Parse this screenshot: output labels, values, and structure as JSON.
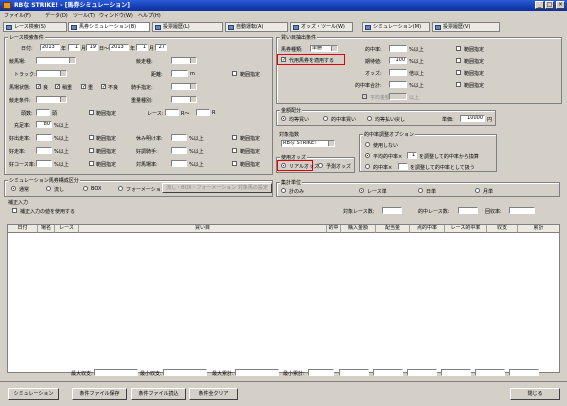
{
  "window": {
    "title": "RBな STRIKE! - [馬券シミュレーション]",
    "minimize": "_",
    "maximize": "□",
    "close": "×"
  },
  "menu": [
    "ファイル(F)",
    "データ(D)",
    "ツール(T)",
    "ウィンドウ(W)",
    "ヘルプ(H)"
  ],
  "tabs": [
    "レース検索(S)",
    "馬券シミュレーション(B)",
    "投票履歴(L)",
    "自動運転(A)",
    "オッズ・ツール(W)",
    "シミュレーション(M)",
    "投票履歴(V)"
  ],
  "race": {
    "title": "レース検索条件",
    "date_label": "日付:",
    "from_year": "2013",
    "year_label": "年",
    "from_month": "1",
    "month_label": "月",
    "from_day": "19",
    "day_label": "日〜",
    "to_year": "2013",
    "to_month": "1",
    "to_day": "27",
    "venue_label": "競馬場:",
    "racetype_label": "競走種:",
    "track_label": "トラック:",
    "distance_label": "距離:",
    "distance_unit": "m",
    "range_label": "範囲指定",
    "condition_label": "馬場状態:",
    "cond_items": [
      "良",
      "稍重",
      "重",
      "不良"
    ],
    "jockey_label": "騎手指定:",
    "class_label": "競走条件:",
    "weight_label": "重量種別:",
    "heads_label": "頭数:",
    "heads_unit": "頭",
    "range_spec": "範囲指定",
    "race_label": "レース:",
    "race_r1": "R〜",
    "race_r2": "R",
    "hit_label": "充足率:",
    "hit_value": "80",
    "hit_unit": "%以上",
    "rate_rows": [
      [
        "好出走率:",
        "%以上",
        "休み明け率:",
        "%以上"
      ],
      [
        "好走率:",
        "%以上",
        "好調騎手:",
        "%以上"
      ],
      [
        "好コース率:",
        "%以上",
        "対馬場率:",
        "%以上"
      ]
    ]
  },
  "buy": {
    "title": "買い目抽出条件",
    "bet_type_label": "馬券種類:",
    "bet_type": "単勝",
    "auto_label": "代用馬券を適用する",
    "win_rate_label": "的中率:",
    "win_rate_unit": "%以上",
    "win_exp_label": "期待値:",
    "win_exp": "100",
    "exp_unit": "%以上",
    "odds_label": "オッズ:",
    "odds_unit": "倍以上",
    "total_label": "的中率合計:",
    "total_unit": "%以上",
    "cap_label": "平均金額",
    "cap_unit": "以上",
    "range": "範囲指定"
  },
  "money": {
    "title": "金額配分",
    "opts": [
      "均等買い",
      "的中率買い",
      "均等払い戻し"
    ],
    "unit_label": "単価:",
    "unit_value": "10000",
    "unit_suffix": "円"
  },
  "target": {
    "title": "対象指数",
    "value": "RBな STRIKE!"
  },
  "odds_use": {
    "title": "使用オッズ",
    "opts": [
      "リアルオッズ",
      "予測オッズ"
    ]
  },
  "hit_adj": {
    "title": "的中率調整オプション",
    "opts": [
      "使用しない",
      "平均的中率×",
      "的中率×"
    ],
    "v1": "1",
    "s1": "を調整して的中率から換算",
    "s2": "を調整して的中率として扱う"
  },
  "agg": {
    "title": "集計単位",
    "opts": [
      "計のみ",
      "レース単",
      "日単",
      "月単"
    ]
  },
  "sim": {
    "title": "シミュレーション馬券構成区分",
    "opts": [
      "通常",
      "流し",
      "BOX",
      "フォーメーション"
    ],
    "btn": "流し・BOX・フォーメーション 対象馬の設定"
  },
  "fix": {
    "title": "補正入力",
    "check": "補正入力の値を使用する"
  },
  "counts": {
    "race_count": "対象レース数:",
    "hit_count": "的中レース数:",
    "rec_rate": "回収率:"
  },
  "grid": {
    "cols": [
      "日付",
      "場名",
      "レース",
      "買い目",
      "的中",
      "購入金額",
      "配当金",
      "点的中率",
      "レース的中率",
      "収支",
      "累計"
    ]
  },
  "totals": {
    "labels": [
      "最大収支:",
      "最小収支:",
      "最大累計:",
      "最小累計:"
    ]
  },
  "footer": {
    "sim": "シミュレーション",
    "save": "条件ファイル保存",
    "load": "条件ファイル読込",
    "clear": "条件全クリア",
    "close": "閉じる"
  }
}
